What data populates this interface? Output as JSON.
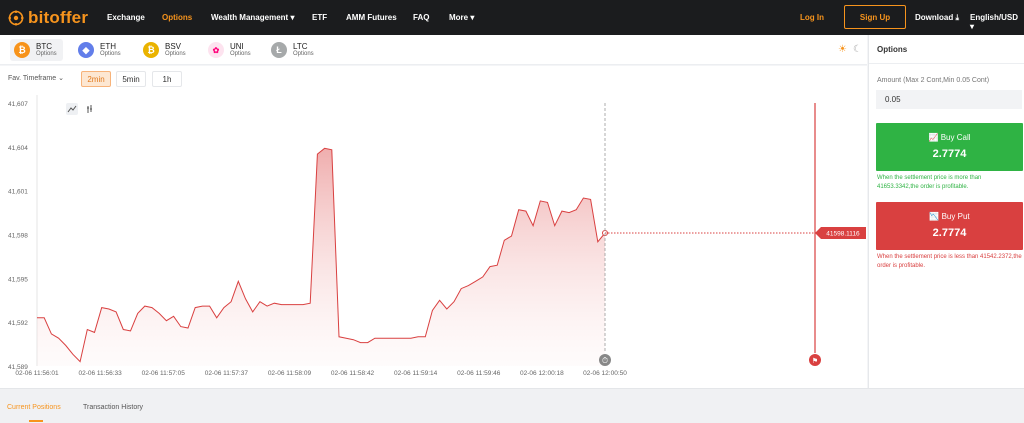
{
  "brand": {
    "name": "bitoffer",
    "color": "#f7941d"
  },
  "nav": {
    "items": [
      {
        "label": "Exchange",
        "active": false,
        "dropdown": false
      },
      {
        "label": "Options",
        "active": true,
        "dropdown": false
      },
      {
        "label": "Wealth Management",
        "active": false,
        "dropdown": true
      },
      {
        "label": "ETF",
        "active": false,
        "dropdown": false
      },
      {
        "label": "AMM Futures",
        "active": false,
        "dropdown": false
      },
      {
        "label": "FAQ",
        "active": false,
        "dropdown": false
      },
      {
        "label": "More",
        "active": false,
        "dropdown": true
      }
    ],
    "login": "Log In",
    "signup": "Sign Up",
    "download": "Download",
    "language": "English/USD"
  },
  "assets": [
    {
      "symbol": "BTC",
      "sub": "Options",
      "color": "#f7931a",
      "glyph": "₿",
      "active": true
    },
    {
      "symbol": "ETH",
      "sub": "Options",
      "color": "#627eea",
      "glyph": "◆",
      "active": false
    },
    {
      "symbol": "BSV",
      "sub": "Options",
      "color": "#eab300",
      "glyph": "₿",
      "active": false
    },
    {
      "symbol": "UNI",
      "sub": "Options",
      "color": "#ff007a",
      "glyph": "🦄",
      "active": false
    },
    {
      "symbol": "LTC",
      "sub": "Options",
      "color": "#a6a9aa",
      "glyph": "Ł",
      "active": false
    }
  ],
  "timeframe": {
    "label": "Fav. Timeframe",
    "options": [
      {
        "label": "2min",
        "active": true
      },
      {
        "label": "5min",
        "active": false
      },
      {
        "label": "1h",
        "active": false
      }
    ]
  },
  "chart_data": {
    "type": "area",
    "yticks": [
      "41,607",
      "41,604",
      "41,601",
      "41,598",
      "41,595",
      "41,592",
      "41,589"
    ],
    "xticks": [
      "02-06 11:56:01",
      "02-06 11:56:33",
      "02-06 11:57:05",
      "02-06 11:57:37",
      "02-06 11:58:09",
      "02-06 11:58:42",
      "02-06 11:59:14",
      "02-06 11:59:46",
      "02-06 12:00:18",
      "02-06 12:00:50"
    ],
    "ylim": [
      41589,
      41607
    ],
    "current_price_label": "41598.1116",
    "line_color": "#d94040",
    "series": [
      {
        "values": [
          41592.3,
          41592.3,
          41591.2,
          41590.9,
          41590.4,
          41589.8,
          41589.3,
          41591.5,
          41591.3,
          41593.0,
          41592.9,
          41592.7,
          41591.5,
          41591.4,
          41592.6,
          41593.1,
          41593.0,
          41592.6,
          41592.1,
          41592.4,
          41591.7,
          41591.6,
          41593.0,
          41593.1,
          41593.1,
          41592.3,
          41593.0,
          41593.4,
          41594.8,
          41593.6,
          41592.7,
          41593.4,
          41593.1,
          41593.3,
          41593.2,
          41593.2,
          41593.2,
          41593.2,
          41593.3,
          41603.5,
          41603.9,
          41603.8,
          41591.0,
          41590.9,
          41590.8,
          41590.6,
          41590.6,
          41590.9,
          41590.9,
          41590.9,
          41590.9,
          41590.9,
          41590.9,
          41591.0,
          41591.0,
          41592.8,
          41593.5,
          41592.9,
          41593.4,
          41594.3,
          41594.5,
          41594.8,
          41595.1,
          41595.8,
          41595.9,
          41597.6,
          41597.9,
          41599.7,
          41599.6,
          41598.6,
          41600.3,
          41600.2,
          41598.6,
          41599.6,
          41599.5,
          41599.7,
          41600.5,
          41600.4,
          41597.5,
          41598.1
        ]
      }
    ]
  },
  "panel": {
    "title": "Options",
    "amount_label": "Amount (Max 2 Cont,Min 0.05 Cont)",
    "amount_value": "0.05",
    "call": {
      "label": "Buy Call",
      "value": "2.7774",
      "color": "#2fb344",
      "hint": "When the settlement price is more than 41653.3342,the order is profitable."
    },
    "put": {
      "label": "Buy Put",
      "value": "2.7774",
      "color": "#d94040",
      "hint": "When the settlement price is less than 41542.2372,the order is profitable."
    }
  },
  "bottom_tabs": [
    {
      "label": "Current Positions",
      "active": true
    },
    {
      "label": "Transaction History",
      "active": false
    }
  ]
}
